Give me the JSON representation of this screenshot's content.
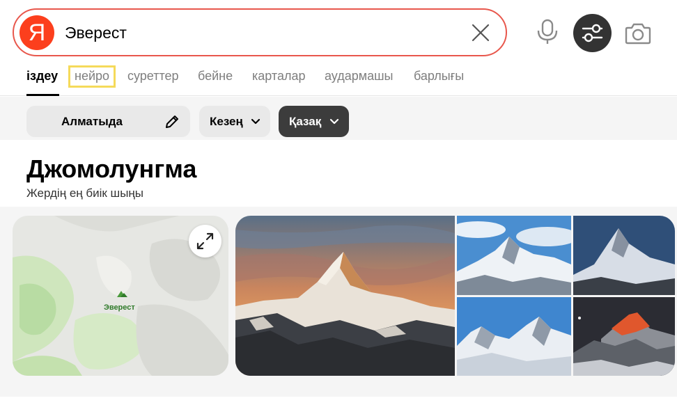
{
  "search": {
    "query": "Эверест",
    "logo_letter": "Я"
  },
  "header_icons": {
    "clear": "close-icon",
    "voice": "microphone-icon",
    "filters": "sliders-icon",
    "camera": "camera-icon"
  },
  "tabs": [
    {
      "label": "іздеу",
      "active": true
    },
    {
      "label": "нейро",
      "active": false,
      "highlighted": true
    },
    {
      "label": "суреттер",
      "active": false
    },
    {
      "label": "бейне",
      "active": false
    },
    {
      "label": "карталар",
      "active": false
    },
    {
      "label": "аудармашы",
      "active": false
    },
    {
      "label": "барлығы",
      "active": false
    }
  ],
  "filters": {
    "region": "Алматыда",
    "period": "Кезең",
    "language": "Қазақ"
  },
  "entity": {
    "title": "Джомолунгма",
    "subtitle": "Жердің ең биік шыңы",
    "map_label": "Эверест"
  },
  "colors": {
    "search_border": "#e8574c",
    "logo": "#fc3f1d",
    "tab_highlight": "#f5da5a",
    "dark_button": "#333333"
  }
}
